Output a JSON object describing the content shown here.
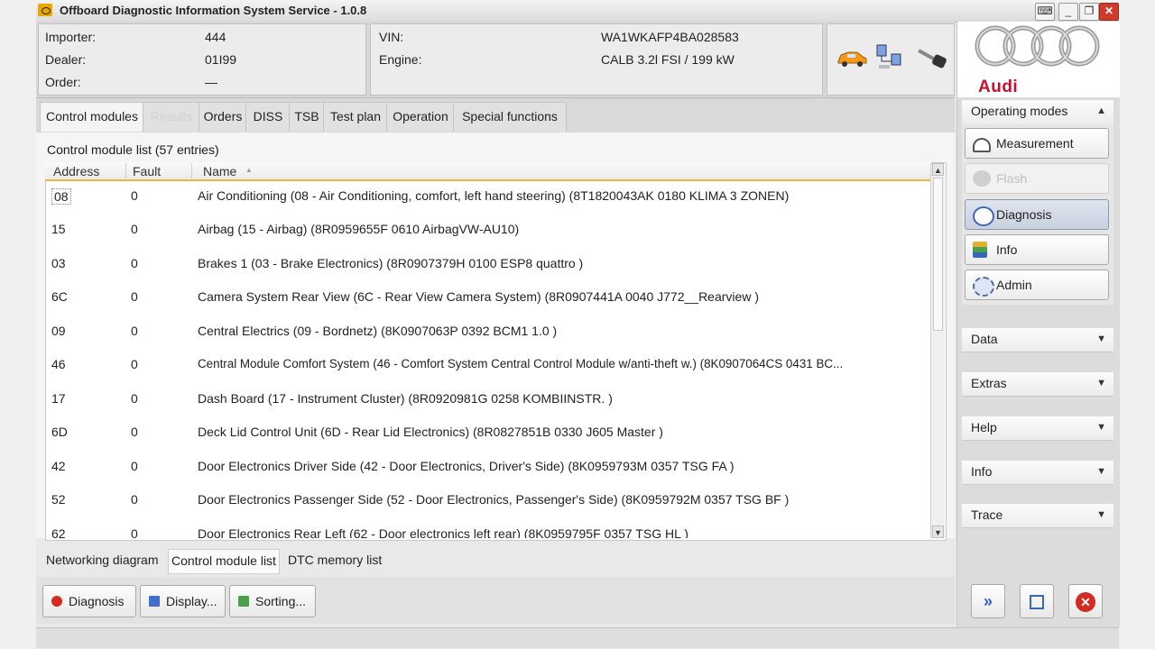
{
  "window": {
    "title": "Offboard Diagnostic Information System Service - 1.0.8"
  },
  "vehicle": {
    "importer_label": "Importer:",
    "importer": "444",
    "dealer_label": "Dealer:",
    "dealer": "01I99",
    "order_label": "Order:",
    "order": "—",
    "vin_label": "VIN:",
    "vin": "WA1WKAFP4BA028583",
    "engine_label": "Engine:",
    "engine": "CALB 3.2l FSI / 199 kW"
  },
  "tabs": [
    {
      "label": "Control modules"
    },
    {
      "label": "Results"
    },
    {
      "label": "Orders"
    },
    {
      "label": "DISS"
    },
    {
      "label": "TSB"
    },
    {
      "label": "Test plan"
    },
    {
      "label": "Operation"
    },
    {
      "label": "Special functions"
    }
  ],
  "list": {
    "title": "Control module list (57 entries)",
    "columns": {
      "address": "Address",
      "fault": "Fault",
      "name": "Name"
    },
    "rows": [
      {
        "address": "08",
        "fault": "0",
        "name": "Air Conditioning (08 - Air Conditioning, comfort, left hand steering) (8T1820043AK   0180   KLIMA 3 ZONEN)"
      },
      {
        "address": "15",
        "fault": "0",
        "name": "Airbag (15 - Airbag) (8R0959655F   0610   AirbagVW-AU10)"
      },
      {
        "address": "03",
        "fault": "0",
        "name": "Brakes 1 (03 - Brake Electronics) (8R0907379H    0100   ESP8 quattro )"
      },
      {
        "address": "6C",
        "fault": "0",
        "name": "Camera System Rear View (6C - Rear View Camera System) (8R0907441A     0040   J772__Rearview     )"
      },
      {
        "address": "09",
        "fault": "0",
        "name": "Central Electrics (09 - Bordnetz) (8K0907063P    0392   BCM1 1.0     )"
      },
      {
        "address": "46",
        "fault": "0",
        "name": "Central Module Comfort System (46 - Comfort System Central Control Module w/anti-theft w.) (8K0907064CS   0431   BC..."
      },
      {
        "address": "17",
        "fault": "0",
        "name": "Dash Board (17 - Instrument Cluster) (8R0920981G    0258   KOMBIINSTR.  )"
      },
      {
        "address": "6D",
        "fault": "0",
        "name": "Deck Lid Control Unit (6D - Rear Lid Electronics) (8R0827851B     0330   J605  Master )"
      },
      {
        "address": "42",
        "fault": "0",
        "name": "Door Electronics Driver Side (42 - Door Electronics, Driver's Side) (8K0959793M     0357   TSG FA       )"
      },
      {
        "address": "52",
        "fault": "0",
        "name": "Door Electronics Passenger Side (52 - Door Electronics, Passenger's Side) (8K0959792M     0357   TSG BF       )"
      },
      {
        "address": "62",
        "fault": "0",
        "name": "Door Electronics Rear Left (62 - Door electronics left rear) (8K0959795F    0357   TSG HL       )"
      }
    ]
  },
  "bottom_tabs": [
    {
      "label": "Networking diagram"
    },
    {
      "label": "Control module list"
    },
    {
      "label": "DTC memory list"
    }
  ],
  "actions": {
    "diagnosis": "Diagnosis",
    "display": "Display...",
    "sorting": "Sorting..."
  },
  "brand": {
    "name": "Audi",
    "color": "#c8102e"
  },
  "operating_modes": {
    "title": "Operating modes",
    "items": [
      {
        "label": "Measurement",
        "icon": "gauge-icon"
      },
      {
        "label": "Flash",
        "icon": "flash-icon"
      },
      {
        "label": "Diagnosis",
        "icon": "stethoscope-icon"
      },
      {
        "label": "Info",
        "icon": "books-icon"
      },
      {
        "label": "Admin",
        "icon": "gear-icon"
      }
    ]
  },
  "sections": [
    {
      "label": "Data"
    },
    {
      "label": "Extras"
    },
    {
      "label": "Help"
    },
    {
      "label": "Info"
    },
    {
      "label": "Trace"
    }
  ]
}
